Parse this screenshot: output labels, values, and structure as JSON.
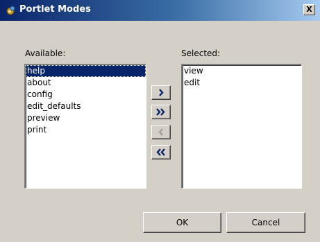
{
  "window": {
    "title": "Portlet Modes",
    "close_label": "X"
  },
  "available": {
    "label": "Available:",
    "items": [
      "help",
      "about",
      "config",
      "edit_defaults",
      "preview",
      "print"
    ],
    "selected_item": "help"
  },
  "selected": {
    "label": "Selected:",
    "items": [
      "view",
      "edit"
    ]
  },
  "transfer_buttons": [
    {
      "icon": "chevron-right-icon",
      "enabled": true
    },
    {
      "icon": "double-chevron-right-icon",
      "enabled": true
    },
    {
      "icon": "chevron-left-icon",
      "enabled": false
    },
    {
      "icon": "double-chevron-left-icon",
      "enabled": true
    }
  ],
  "buttons": {
    "ok_label": "OK",
    "cancel_label": "Cancel"
  },
  "colors": {
    "title_bar_start": "#0a246a",
    "title_bar_end": "#a6caf0",
    "selection": "#0a246a",
    "dialog_background": "#d4d0c8"
  }
}
